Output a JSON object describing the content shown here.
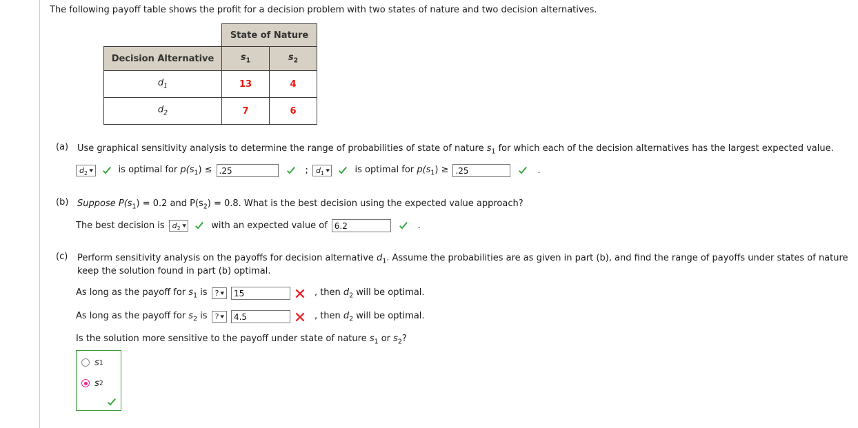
{
  "intro": "The following payoff table shows the profit for a decision problem with two states of nature and two decision alternatives.",
  "table": {
    "group_header": "State of Nature",
    "row_header": "Decision Alternative",
    "col_headers": [
      "s",
      "s"
    ],
    "col_header_subs": [
      "1",
      "2"
    ],
    "rows": [
      {
        "alt": "d",
        "alt_sub": "1",
        "values": [
          "13",
          "4"
        ]
      },
      {
        "alt": "d",
        "alt_sub": "2",
        "values": [
          "7",
          "6"
        ]
      }
    ],
    "header_bg": "#d7d0c4",
    "value_color": "#e8160c"
  },
  "parts": {
    "a": {
      "label": "(a)",
      "prompt_1": "Use graphical sensitivity analysis to determine the range of probabilities of state of nature ",
      "prompt_s": "s",
      "prompt_s_sub": "1",
      "prompt_2": " for which each of the decision alternatives has the largest expected value.",
      "select1_value": "d",
      "select1_sub": "2",
      "text_1": "is optimal for ",
      "text_p": "p(s",
      "text_p_sub": "1",
      "text_p_end": ") ≤",
      "input1_value": ".25",
      "separator": ";",
      "select2_value": "d",
      "select2_sub": "1",
      "text_2": "is optimal for ",
      "text_p2_end": ") ≥",
      "input2_value": ".25",
      "period": ".",
      "status1": "correct",
      "status2": "correct",
      "status3": "correct",
      "status4": "correct"
    },
    "b": {
      "label": "(b)",
      "prompt_1": "Suppose P(s",
      "prompt_sub_1": "1",
      "prompt_2": ") = 0.2 and P(s",
      "prompt_sub_2": "2",
      "prompt_3": ") = 0.8. What is the best decision using the expected value approach?",
      "answer_lead": "The best decision is",
      "select_value": "d",
      "select_sub": "2",
      "answer_mid": "with an expected value of",
      "input_value": "6.2",
      "period": ".",
      "status1": "correct",
      "status2": "correct"
    },
    "c": {
      "label": "(c)",
      "prompt_1": "Perform sensitivity analysis on the payoffs for decision alternative ",
      "prompt_d": "d",
      "prompt_d_sub": "1",
      "prompt_2": ". Assume the probabilities are as given in part (b), and find the range of payoffs under states of nature ",
      "prompt_line2": "keep the solution found in part (b) optimal.",
      "rows": [
        {
          "lead": "As long as the payoff for ",
          "s": "s",
          "s_sub": "1",
          "is": " is",
          "select_value": "?",
          "input_value": "15",
          "status": "incorrect",
          "tail_1": ", then ",
          "tail_d": "d",
          "tail_d_sub": "2",
          "tail_2": " will be optimal."
        },
        {
          "lead": "As long as the payoff for ",
          "s": "s",
          "s_sub": "2",
          "is": " is",
          "select_value": "?",
          "input_value": "4.5",
          "status": "incorrect",
          "tail_1": ", then ",
          "tail_d": "d",
          "tail_d_sub": "2",
          "tail_2": " will be optimal."
        }
      ],
      "final_question_1": "Is the solution more sensitive to the payoff under state of nature ",
      "final_q_s1": "s",
      "final_q_s1_sub": "1",
      "final_question_2": " or ",
      "final_q_s2": "s",
      "final_q_s2_sub": "2",
      "final_question_3": "?",
      "options": [
        {
          "label": "s",
          "sub": "1",
          "selected": false
        },
        {
          "label": "s",
          "sub": "2",
          "selected": true
        }
      ],
      "status": "correct"
    }
  },
  "colors": {
    "correct": "#38a83d",
    "incorrect": "#ed1c24",
    "radio_selected": "#ef1f8c",
    "rule": "#cccccc"
  }
}
